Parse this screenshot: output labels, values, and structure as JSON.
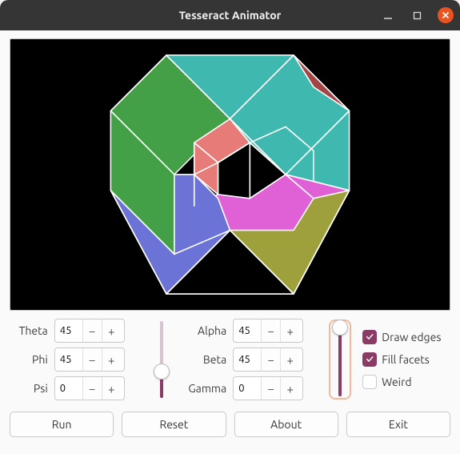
{
  "window": {
    "title": "Tesseract Animator"
  },
  "angles": {
    "theta": {
      "label": "Theta",
      "value": "45"
    },
    "phi": {
      "label": "Phi",
      "value": "45"
    },
    "psi": {
      "label": "Psi",
      "value": "0"
    },
    "alpha": {
      "label": "Alpha",
      "value": "45"
    },
    "beta": {
      "label": "Beta",
      "value": "45"
    },
    "gamma": {
      "label": "Gamma",
      "value": "0"
    }
  },
  "sliders": {
    "left": {
      "fill_pct": 34,
      "thumb_pct": 34
    },
    "right": {
      "fill_pct": 92,
      "thumb_pct": 92,
      "selected": true
    }
  },
  "checks": {
    "draw_edges": {
      "label": "Draw edges",
      "checked": true
    },
    "fill_facets": {
      "label": "Fill facets",
      "checked": true
    },
    "weird": {
      "label": "Weird",
      "checked": false
    }
  },
  "buttons": {
    "run": "Run",
    "reset": "Reset",
    "about": "About",
    "exit": "Exit"
  },
  "glyph": {
    "minus": "−",
    "plus": "+"
  },
  "facet_colors": {
    "green": "#43a047",
    "teal": "#3fb8b0",
    "brown": "#a14545",
    "blue": "#6b74d6",
    "magenta": "#e060d6",
    "olive": "#9ea03b",
    "salmon": "#e77b77"
  }
}
